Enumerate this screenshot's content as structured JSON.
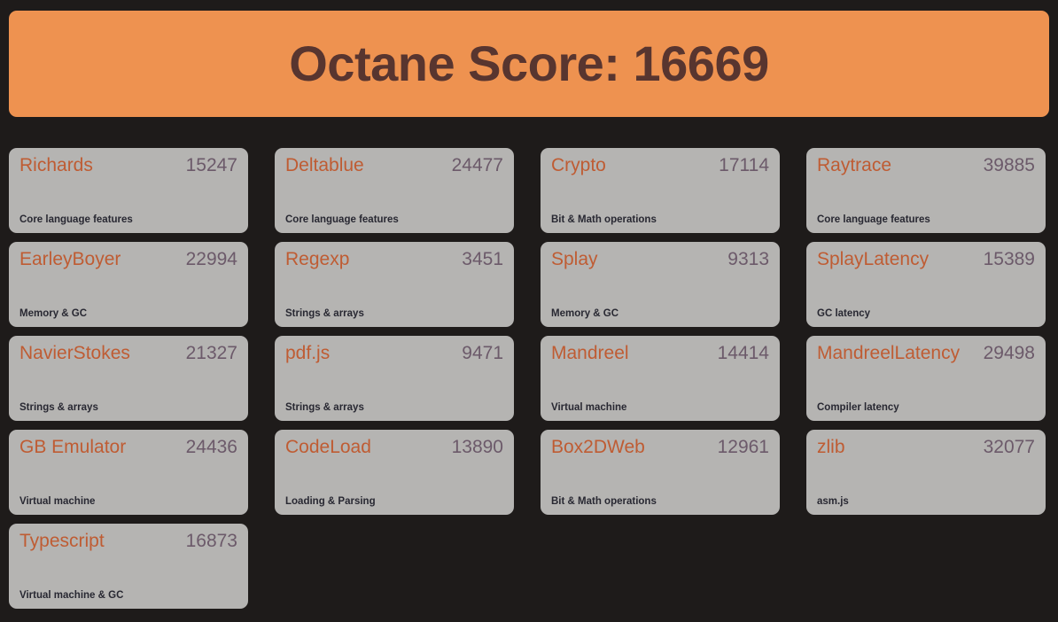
{
  "header": {
    "label": "Octane Score:",
    "score": "16669",
    "full_text": "Octane Score: 16669",
    "background_color": "#ee9250",
    "text_color": "#58352f"
  },
  "theme": {
    "page_background": "#1e1b1a",
    "card_background": "#b5b4b2",
    "benchmark_name_color": "#bf5c33",
    "benchmark_score_color": "#6c5a6a",
    "category_color": "#282832"
  },
  "benchmarks": [
    {
      "name": "Richards",
      "score": "15247",
      "category": "Core language features"
    },
    {
      "name": "Deltablue",
      "score": "24477",
      "category": "Core language features"
    },
    {
      "name": "Crypto",
      "score": "17114",
      "category": "Bit & Math operations"
    },
    {
      "name": "Raytrace",
      "score": "39885",
      "category": "Core language features"
    },
    {
      "name": "EarleyBoyer",
      "score": "22994",
      "category": "Memory & GC"
    },
    {
      "name": "Regexp",
      "score": "3451",
      "category": "Strings & arrays"
    },
    {
      "name": "Splay",
      "score": "9313",
      "category": "Memory & GC"
    },
    {
      "name": "SplayLatency",
      "score": "15389",
      "category": "GC latency"
    },
    {
      "name": "NavierStokes",
      "score": "21327",
      "category": "Strings & arrays"
    },
    {
      "name": "pdf.js",
      "score": "9471",
      "category": "Strings & arrays"
    },
    {
      "name": "Mandreel",
      "score": "14414",
      "category": "Virtual machine"
    },
    {
      "name": "MandreelLatency",
      "score": "29498",
      "category": "Compiler latency"
    },
    {
      "name": "GB Emulator",
      "score": "24436",
      "category": "Virtual machine"
    },
    {
      "name": "CodeLoad",
      "score": "13890",
      "category": "Loading & Parsing"
    },
    {
      "name": "Box2DWeb",
      "score": "12961",
      "category": "Bit & Math operations"
    },
    {
      "name": "zlib",
      "score": "32077",
      "category": "asm.js"
    },
    {
      "name": "Typescript",
      "score": "16873",
      "category": "Virtual machine & GC"
    }
  ]
}
